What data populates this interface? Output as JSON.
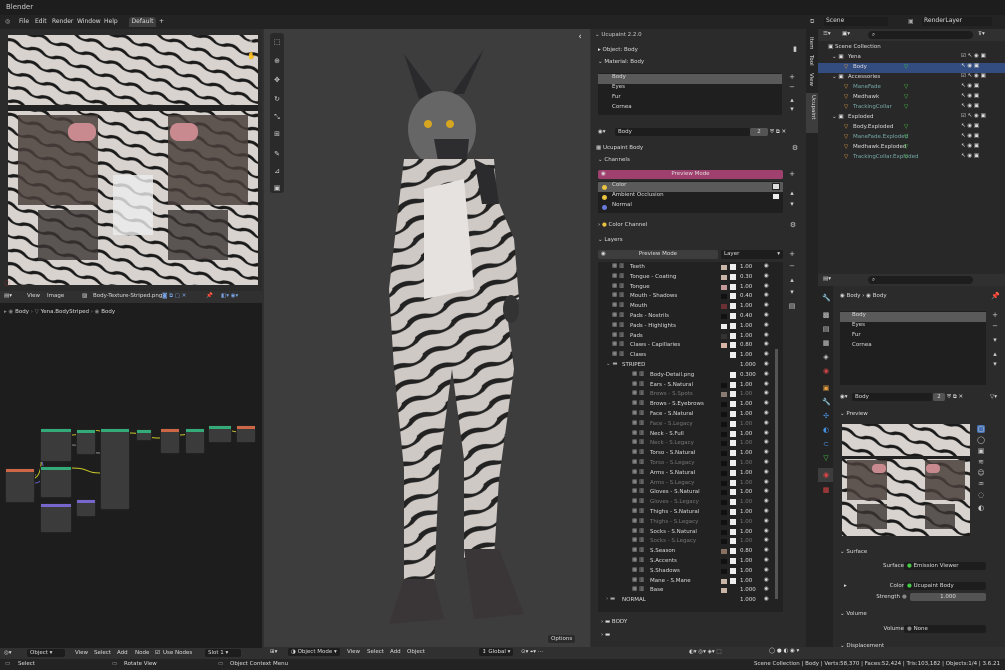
{
  "window": {
    "title": "Blender"
  },
  "menus": [
    "File",
    "Edit",
    "Render",
    "Window",
    "Help"
  ],
  "workspace_tab": "Default",
  "scene": "Scene",
  "render_layer": "RenderLayer",
  "image_editor": {
    "view": "View",
    "image": "Image",
    "image_name": "Body-Texture-Striped.png"
  },
  "node_editor": {
    "breadcrumb": [
      "Body",
      "Yena.BodyStriped",
      "Body"
    ],
    "object_mode": "Object",
    "menu": [
      "View",
      "Select",
      "Add",
      "Node"
    ],
    "use_nodes": "Use Nodes",
    "slot": "Slot 1"
  },
  "viewport": {
    "mode": "Object Mode",
    "menu": [
      "View",
      "Select",
      "Add",
      "Object"
    ],
    "orientation": "Global",
    "options": "Options"
  },
  "side_tabs": [
    "Item",
    "Tool",
    "View",
    "Ucupaint"
  ],
  "ucupaint": {
    "header": "Ucupaint 2.2.0",
    "object": "Object: Body",
    "material": "Material: Body",
    "materials": [
      "Body",
      "Eyes",
      "Fur",
      "Cornea"
    ],
    "mat_field": "Body",
    "mat_users": "2",
    "node_label": "Ucupaint Body",
    "channels_label": "Channels",
    "preview_mode": "Preview Mode",
    "channels": [
      "Color",
      "Ambient Occlusion",
      "Normal"
    ],
    "color_channel": "Color Channel",
    "layers_label": "Layers",
    "layers_dropdown": "Layer",
    "layers": [
      {
        "name": "Teeth",
        "val": "1.00",
        "sw": "#c9b5a8",
        "d": 1
      },
      {
        "name": "Tongue - Coating",
        "val": "0.30",
        "sw": "#c9b5a8",
        "d": 1
      },
      {
        "name": "Tongue",
        "val": "1.00",
        "sw": "#c39a97",
        "d": 1
      },
      {
        "name": "Mouth - Shadows",
        "val": "0.40",
        "sw": "#111",
        "d": 1
      },
      {
        "name": "Mouth",
        "val": "1.00",
        "sw": "#6b3034",
        "d": 1
      },
      {
        "name": "Pads - Nostrils",
        "val": "0.40",
        "sw": "#111",
        "d": 1
      },
      {
        "name": "Pads - Highlights",
        "val": "1.00",
        "sw": "#eee",
        "d": 1
      },
      {
        "name": "Pads",
        "val": "1.00",
        "sw": "#333",
        "d": 1
      },
      {
        "name": "Claws - Capillaries",
        "val": "0.80",
        "sw": "#d7b4a6",
        "d": 1
      },
      {
        "name": "Claws",
        "val": "1.00",
        "sw": "#222",
        "d": 1
      },
      {
        "name": "STRIPED",
        "val": "1.000",
        "d": 0,
        "folder": true
      },
      {
        "name": "Body-Detail.png",
        "val": "0.300",
        "d": 2
      },
      {
        "name": "Ears - S.Natural",
        "val": "1.00",
        "sw": "#111",
        "d": 2
      },
      {
        "name": "Brows - S.Spots",
        "val": "1.00",
        "sw": "#8a7a74",
        "d": 2,
        "dim": true
      },
      {
        "name": "Brows - S.Eyebrows",
        "val": "1.00",
        "sw": "#111",
        "d": 2
      },
      {
        "name": "Face - S.Natural",
        "val": "1.00",
        "sw": "#111",
        "d": 2
      },
      {
        "name": "Face - S.Legacy",
        "val": "1.00",
        "sw": "#111",
        "d": 2,
        "dim": true
      },
      {
        "name": "Neck - S.Full",
        "val": "1.00",
        "sw": "#111",
        "d": 2
      },
      {
        "name": "Neck - S.Legacy",
        "val": "1.00",
        "sw": "#111",
        "d": 2,
        "dim": true
      },
      {
        "name": "Torso - S.Natural",
        "val": "1.00",
        "sw": "#111",
        "d": 2
      },
      {
        "name": "Torso - S.Legacy",
        "val": "1.00",
        "sw": "#111",
        "d": 2,
        "dim": true
      },
      {
        "name": "Arms - S.Natural",
        "val": "1.00",
        "sw": "#111",
        "d": 2
      },
      {
        "name": "Arms - S.Legacy",
        "val": "1.00",
        "sw": "#111",
        "d": 2,
        "dim": true
      },
      {
        "name": "Gloves - S.Natural",
        "val": "1.00",
        "sw": "#111",
        "d": 2
      },
      {
        "name": "Gloves - S.Legacy",
        "val": "1.00",
        "sw": "#111",
        "d": 2,
        "dim": true
      },
      {
        "name": "Thighs - S.Natural",
        "val": "1.00",
        "sw": "#111",
        "d": 2
      },
      {
        "name": "Thighs - S.Legacy",
        "val": "1.00",
        "sw": "#111",
        "d": 2,
        "dim": true
      },
      {
        "name": "Socks - S.Natural",
        "val": "1.00",
        "sw": "#111",
        "d": 2
      },
      {
        "name": "Socks - S.Legacy",
        "val": "1.00",
        "sw": "#111",
        "d": 2,
        "dim": true
      },
      {
        "name": "S.Season",
        "val": "0.80",
        "sw": "#8a7060",
        "d": 2
      },
      {
        "name": "S.Accents",
        "val": "1.00",
        "sw": "#111",
        "d": 2
      },
      {
        "name": "S.Shadows",
        "val": "1.00",
        "sw": "#111",
        "d": 2
      },
      {
        "name": "Mane - S.Mane",
        "val": "1.00",
        "sw": "#c9b5a8",
        "d": 2
      },
      {
        "name": "Base",
        "val": "1.000",
        "sw": "#c9b5a8",
        "d": 2,
        "nobox": true
      },
      {
        "name": "NORMAL",
        "val": "1.000",
        "d": 0,
        "folder": true,
        "closed": true
      }
    ],
    "body_folder": "BODY"
  },
  "outliner": {
    "root": "Scene Collection",
    "items": [
      {
        "name": "Yena",
        "d": 1,
        "coll": true
      },
      {
        "name": "Body",
        "d": 2,
        "sel": true
      },
      {
        "name": "Accessories",
        "d": 1,
        "coll": true
      },
      {
        "name": "ManeFade",
        "d": 2,
        "dim": true
      },
      {
        "name": "Medhawk",
        "d": 2
      },
      {
        "name": "TrackingCollar",
        "d": 2,
        "dim": true
      },
      {
        "name": "Exploded",
        "d": 1,
        "coll": true
      },
      {
        "name": "Body.Exploded",
        "d": 2
      },
      {
        "name": "ManeFade.Exploded",
        "d": 2,
        "dim": true
      },
      {
        "name": "Medhawk.Exploded",
        "d": 2
      },
      {
        "name": "TrackingCollar.Exploded",
        "d": 2,
        "dim": true
      }
    ]
  },
  "properties": {
    "breadcrumb": [
      "Body",
      "Body"
    ],
    "materials": [
      "Body",
      "Eyes",
      "Fur",
      "Cornea"
    ],
    "mat_field": "Body",
    "mat_users": "2",
    "preview": "Preview",
    "surface": "Surface",
    "surface_label": "Surface",
    "surface_val": "Emission Viewer",
    "color_label": "Color",
    "color_val": "Ucupaint Body",
    "strength_label": "Strength",
    "strength_val": "1.000",
    "volume": "Volume",
    "volume_label": "Volume",
    "volume_val": "None",
    "displacement": "Displacement"
  },
  "status": {
    "select": "Select",
    "rotate": "Rotate View",
    "context": "Object Context Menu",
    "info": "Scene Collection | Body | Verts:58,370 | Faces:52,424 | Tris:103,182 | Objects:1/4 | 3.6.21"
  },
  "colors": {
    "accent": "#4772b3",
    "preview_bar": "#a0406e",
    "yellow": "#e8c440",
    "blue": "#6a7bd9"
  }
}
